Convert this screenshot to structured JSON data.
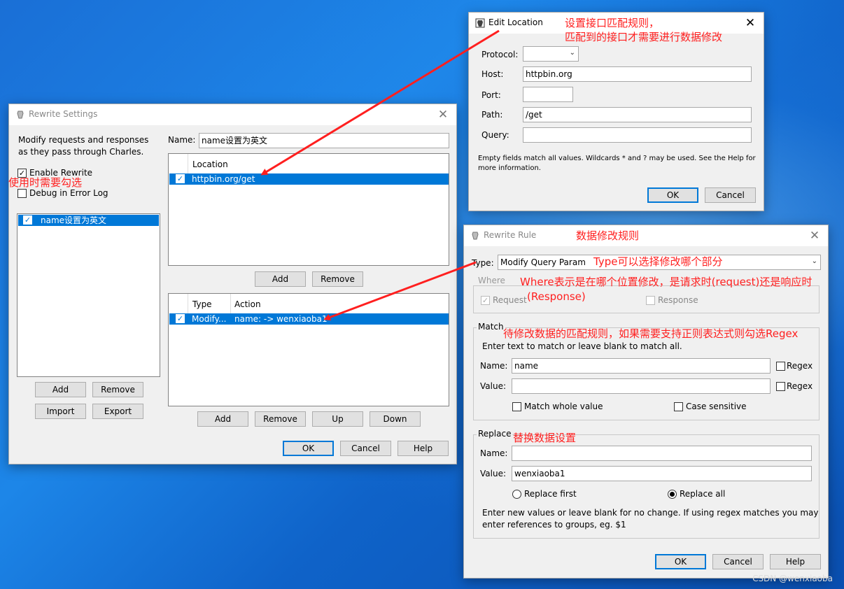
{
  "colors": {
    "accent": "#0078d7",
    "annotation": "#ff1f1f"
  },
  "rewrite_settings": {
    "title": "Rewrite Settings",
    "description": "Modify requests and responses as they pass through Charles.",
    "enable_rewrite": "Enable Rewrite",
    "debug_log": "Debug in Error Log",
    "sets": [
      {
        "label": "name设置为英文",
        "checked": true
      }
    ],
    "add": "Add",
    "remove": "Remove",
    "import": "Import",
    "export": "Export",
    "name_label": "Name:",
    "name_value": "name设置为英文",
    "location_header": "Location",
    "locations": [
      {
        "label": "httpbin.org/get",
        "checked": true
      }
    ],
    "loc_add": "Add",
    "loc_remove": "Remove",
    "type_header": "Type",
    "action_header": "Action",
    "rules": [
      {
        "type": "Modify...",
        "action": "name: -> wenxiaoba1",
        "checked": true
      }
    ],
    "rule_add": "Add",
    "rule_remove": "Remove",
    "rule_up": "Up",
    "rule_down": "Down",
    "ok": "OK",
    "cancel": "Cancel",
    "help": "Help"
  },
  "edit_location": {
    "title": "Edit Location",
    "protocol_label": "Protocol:",
    "protocol_value": "",
    "host_label": "Host:",
    "host_value": "httpbin.org",
    "port_label": "Port:",
    "port_value": "",
    "path_label": "Path:",
    "path_value": "/get",
    "query_label": "Query:",
    "query_value": "",
    "hint_line1": "Empty fields match all values. Wildcards * and ? may be used. See the Help for",
    "hint_line2": "more information.",
    "ok": "OK",
    "cancel": "Cancel"
  },
  "rewrite_rule": {
    "title": "Rewrite Rule",
    "type_label": "Type:",
    "type_value": "Modify Query Param",
    "where_label": "Where",
    "request": "Request",
    "response": "Response",
    "match_label": "Match",
    "match_hint": "Enter text to match or leave blank to match all.",
    "name_label": "Name:",
    "match_name": "name",
    "value_label": "Value:",
    "match_value": "",
    "regex": "Regex",
    "match_whole": "Match whole value",
    "case_sensitive": "Case sensitive",
    "replace_label": "Replace",
    "replace_name": "",
    "replace_value": "wenxiaoba1",
    "replace_first": "Replace first",
    "replace_all": "Replace all",
    "replace_hint1": "Enter new values or leave blank for no change. If using regex matches you may",
    "replace_hint2": "enter references to groups, eg. $1",
    "ok": "OK",
    "cancel": "Cancel",
    "help": "Help"
  },
  "annotations": {
    "location_1": "设置接口匹配规则，",
    "location_2": "匹配到的接口才需要进行数据修改",
    "enable": "使用时需要勾选",
    "rule_title": "数据修改规则",
    "type": "Type可以选择修改哪个部分",
    "where_1": "Where表示是在哪个位置修改，是请求时(request)还是响应时",
    "where_2": "(Response)",
    "match": "待修改数据的匹配规则，如果需要支持正则表达式则勾选Regex",
    "replace": "替换数据设置"
  },
  "watermark": "CSDN @wenxiaoba"
}
